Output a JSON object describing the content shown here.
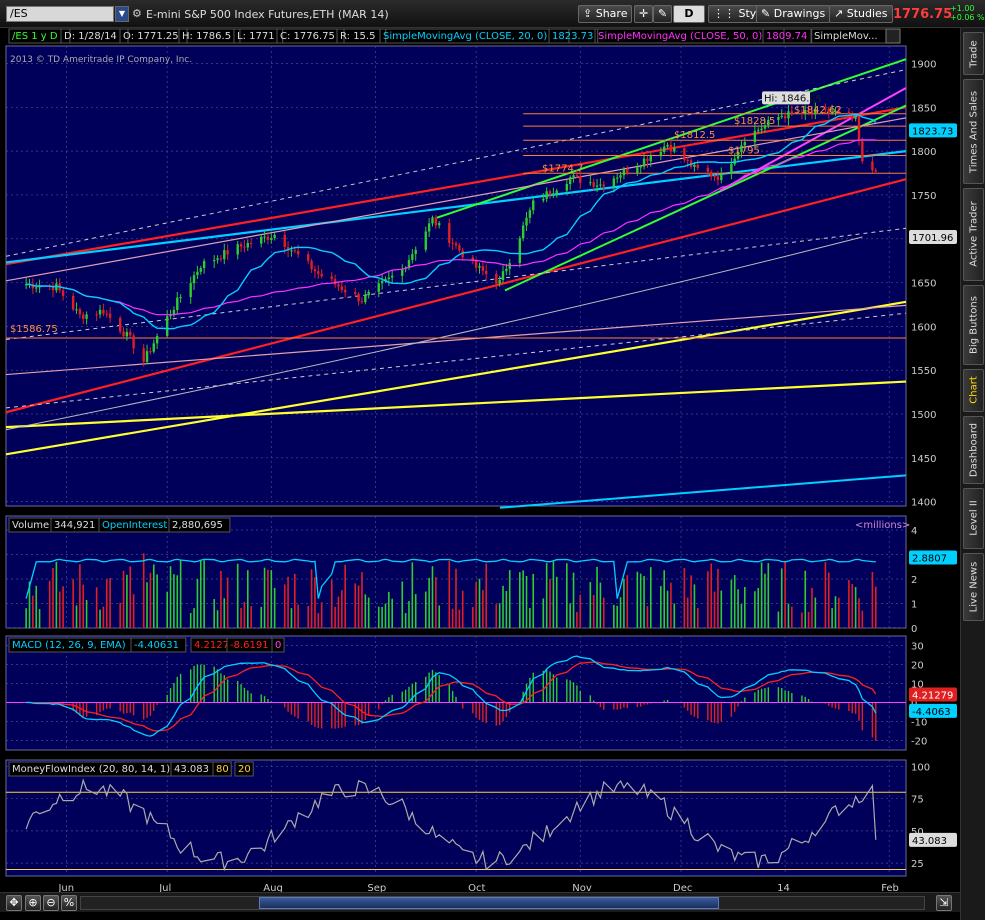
{
  "toolbar": {
    "symbol": "/ES",
    "description": "E-mini S&P 500 Index Futures,ETH (MAR 14)",
    "share": "Share",
    "period": "D",
    "style": "Style",
    "drawings": "Drawings",
    "studies": "Studies",
    "last_price": "1776.75",
    "change": "+1.00",
    "change_pct": "+0.06 %"
  },
  "right_tabs": [
    {
      "label": "Trade",
      "active": false
    },
    {
      "label": "Times And Sales",
      "active": false
    },
    {
      "label": "Active Trader",
      "active": false
    },
    {
      "label": "Big Buttons",
      "active": false
    },
    {
      "label": "Chart",
      "active": true
    },
    {
      "label": "Dashboard",
      "active": false
    },
    {
      "label": "Level II",
      "active": false
    },
    {
      "label": "Live News",
      "active": false
    }
  ],
  "header": {
    "symbol_period": "/ES 1 y D",
    "date": "D: 1/28/14",
    "open": "O: 1771.25",
    "high": "H: 1786.5",
    "low": "L: 1771",
    "close": "C: 1776.75",
    "range": "R: 15.5",
    "sma20_label": "SimpleMovingAvg (CLOSE, 20, 0)",
    "sma20_value": "1823.73",
    "sma50_label": "SimpleMovingAvg (CLOSE, 50, 0)",
    "sma50_value": "1809.74",
    "sma_more": "SimpleMov...",
    "copyright": "2013 © TD Ameritrade IP Company, Inc."
  },
  "annotations": {
    "hi": "Hi: 1846.5",
    "p1842": "$1842.62",
    "p1828": "$1828.5",
    "p1812": "$1812.5",
    "p1795": "$1795",
    "p1774": "$1774.7",
    "p1586": "$1586.75"
  },
  "price_badges": {
    "sma20": "1823.73",
    "sma200": "1701.96"
  },
  "volume_panel": {
    "volume_label": "Volume",
    "volume_value": "344,921",
    "oi_label": "OpenInterest",
    "oi_value": "2,880,695",
    "units": "<millions>",
    "oi_badge": "2.8807",
    "ticks": [
      "4",
      "3",
      "2",
      "1",
      "0"
    ]
  },
  "macd_panel": {
    "label": "MACD (12, 26, 9, EMA)",
    "value": "-4.40631",
    "avg": "4.21279",
    "diff": "-8.6191",
    "zero": "0",
    "badge_avg": "4.21279",
    "badge_value": "-4.4063",
    "ticks": [
      "30",
      "20",
      "10",
      "0",
      "-10",
      "-20"
    ]
  },
  "mfi_panel": {
    "label": "MoneyFlowIndex (20, 80, 14, 1)",
    "value": "43.083",
    "over": "80",
    "under": "20",
    "badge": "43.083",
    "ticks": [
      "100",
      "75",
      "50",
      "25"
    ]
  },
  "colors": {
    "panel_bg": "#00005a",
    "grid": "#4a4a8a",
    "up": "#2ecc2e",
    "down": "#e02020",
    "sma20": "#00d0ff",
    "sma50": "#ff30ff",
    "red_line": "#ff2020",
    "green_line": "#30ff30",
    "yellow_line": "#ffff30"
  },
  "chart_data": {
    "type": "candlestick",
    "x_labels": [
      "Jun",
      "Jul",
      "Aug",
      "Sep",
      "Oct",
      "Nov",
      "Dec",
      "14",
      "Feb"
    ],
    "y_ticks": [
      1900,
      1850,
      1800,
      1750,
      1700,
      1650,
      1600,
      1550,
      1500,
      1450,
      1400
    ],
    "ylim": [
      1395,
      1920
    ],
    "last_bar": {
      "date": "1/28/14",
      "open": 1771.25,
      "high": 1786.5,
      "low": 1771,
      "close": 1776.75
    },
    "close_path": [
      {
        "date": "2013-05-20",
        "close": 1648
      },
      {
        "date": "2013-05-29",
        "close": 1645
      },
      {
        "date": "2013-06-05",
        "close": 1612
      },
      {
        "date": "2013-06-12",
        "close": 1618
      },
      {
        "date": "2013-06-20",
        "close": 1585
      },
      {
        "date": "2013-06-24",
        "close": 1560
      },
      {
        "date": "2013-07-01",
        "close": 1610
      },
      {
        "date": "2013-07-11",
        "close": 1670
      },
      {
        "date": "2013-07-22",
        "close": 1690
      },
      {
        "date": "2013-08-02",
        "close": 1705
      },
      {
        "date": "2013-08-15",
        "close": 1660
      },
      {
        "date": "2013-08-28",
        "close": 1630
      },
      {
        "date": "2013-09-09",
        "close": 1665
      },
      {
        "date": "2013-09-18",
        "close": 1722
      },
      {
        "date": "2013-09-30",
        "close": 1670
      },
      {
        "date": "2013-10-08",
        "close": 1650
      },
      {
        "date": "2013-10-18",
        "close": 1740
      },
      {
        "date": "2013-10-29",
        "close": 1770
      },
      {
        "date": "2013-11-07",
        "close": 1762
      },
      {
        "date": "2013-11-18",
        "close": 1785
      },
      {
        "date": "2013-11-27",
        "close": 1808
      },
      {
        "date": "2013-12-05",
        "close": 1780
      },
      {
        "date": "2013-12-13",
        "close": 1770
      },
      {
        "date": "2013-12-20",
        "close": 1815
      },
      {
        "date": "2013-12-31",
        "close": 1841
      },
      {
        "date": "2014-01-15",
        "close": 1845
      },
      {
        "date": "2014-01-22",
        "close": 1835
      },
      {
        "date": "2014-01-24",
        "close": 1785
      },
      {
        "date": "2014-01-28",
        "close": 1776.75
      }
    ],
    "sma20_last": 1823.73,
    "sma50_last": 1809.74,
    "sma200_last": 1701.96,
    "levels": [
      1842.62,
      1828.5,
      1812.5,
      1795,
      1774.7,
      1586.75
    ],
    "volume": {
      "ylim": [
        0,
        4
      ],
      "oi_last": 2.8807
    },
    "macd": {
      "value": -4.40631,
      "avg": 4.21279,
      "diff": -8.6191,
      "ylim": [
        -25,
        35
      ]
    },
    "mfi": {
      "value": 43.083,
      "overbought": 80,
      "oversold": 20,
      "ylim": [
        15,
        105
      ]
    }
  }
}
